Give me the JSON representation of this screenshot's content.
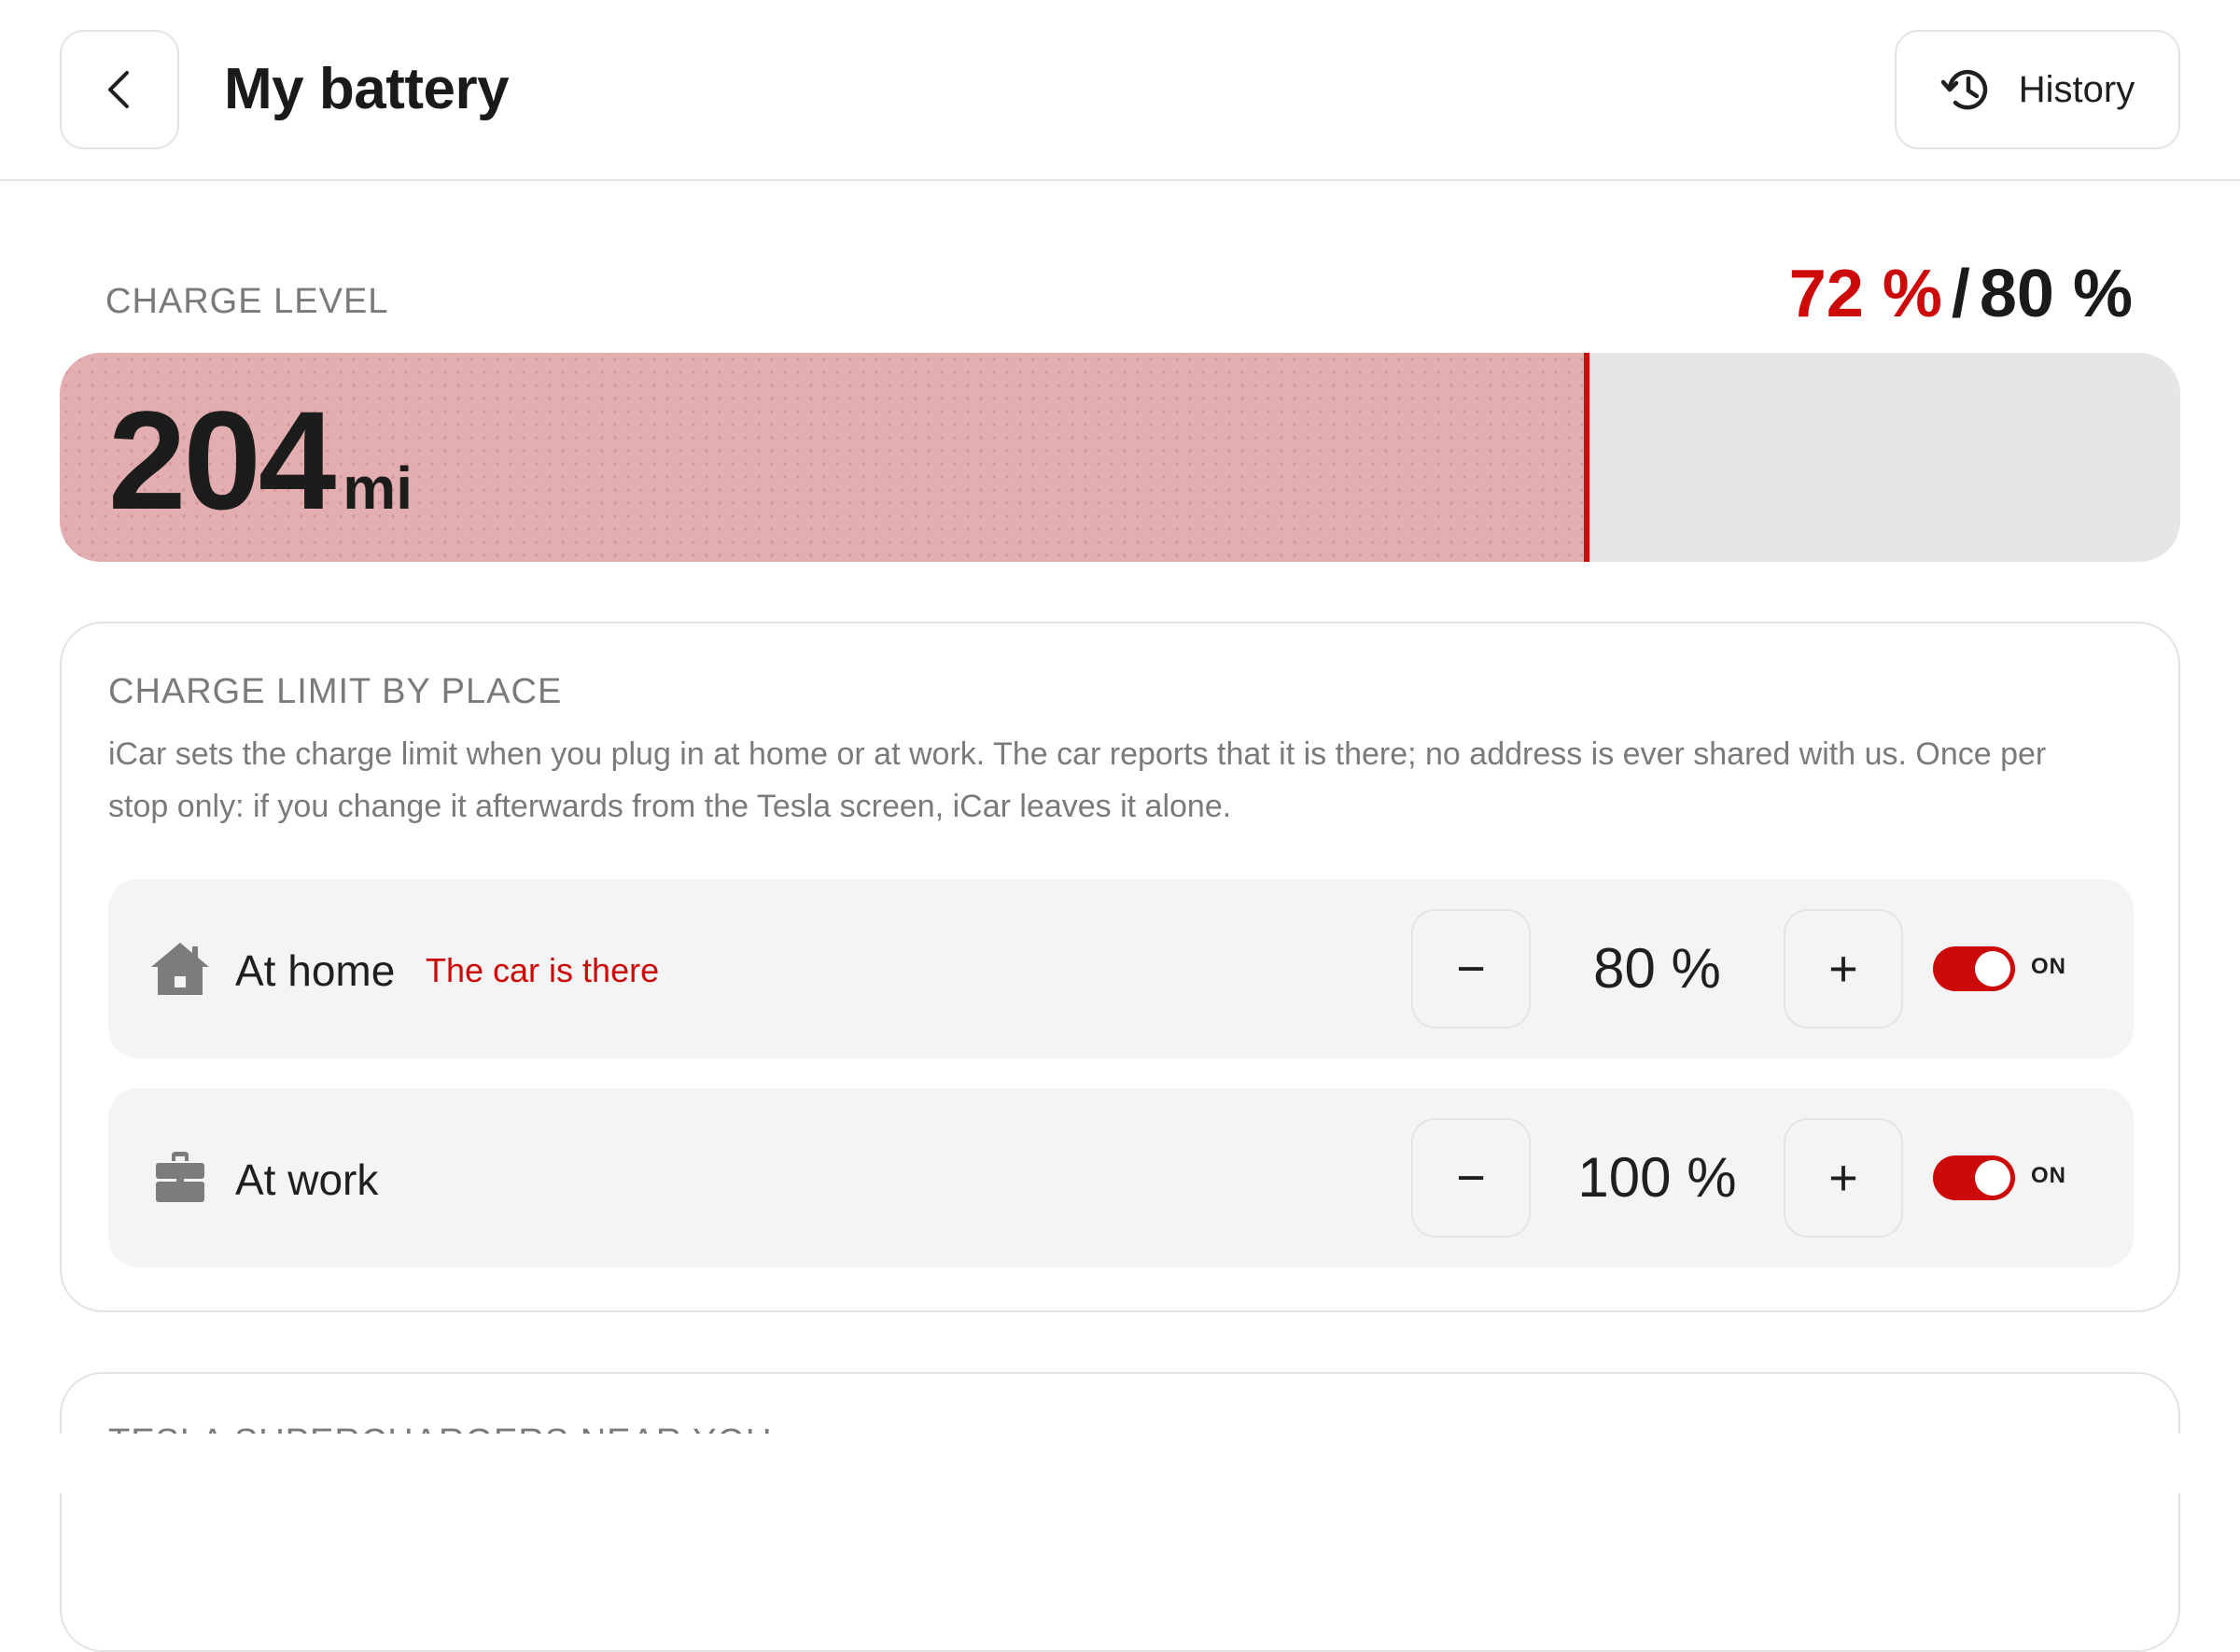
{
  "header": {
    "title": "My battery",
    "back_icon": "chevron-left-icon",
    "history_icon": "history-clock-icon",
    "history_label": "History"
  },
  "charge": {
    "label": "CHARGE LEVEL",
    "current": "72 %",
    "separator": "/",
    "limit": "80 %",
    "current_fraction": 0.72,
    "limit_fraction": 0.72,
    "range_value": "204",
    "range_unit": "mi"
  },
  "places": {
    "heading": "CHARGE LIMIT BY PLACE",
    "description": "iCar sets the charge limit when you plug in at home or at work. The car reports that it is there; no address is ever shared with us. Once per stop only: if you change it afterwards from the Tesla screen, iCar leaves it alone.",
    "items": [
      {
        "icon": "house-icon",
        "name": "At home",
        "status": "The car is there",
        "minus": "−",
        "value": "80 %",
        "plus": "+",
        "toggle_on": true,
        "toggle_label": "ON"
      },
      {
        "icon": "briefcase-icon",
        "name": "At work",
        "status": "",
        "minus": "−",
        "value": "100 %",
        "plus": "+",
        "toggle_on": true,
        "toggle_label": "ON"
      }
    ]
  },
  "next_section": {
    "heading": "TESLA SUPERCHARGERS NEAR YOU"
  },
  "colors": {
    "accent": "#cc0a0a",
    "fill": "#e2aeb0",
    "track": "#e6e6e6",
    "row_bg": "#f4f4f4"
  }
}
